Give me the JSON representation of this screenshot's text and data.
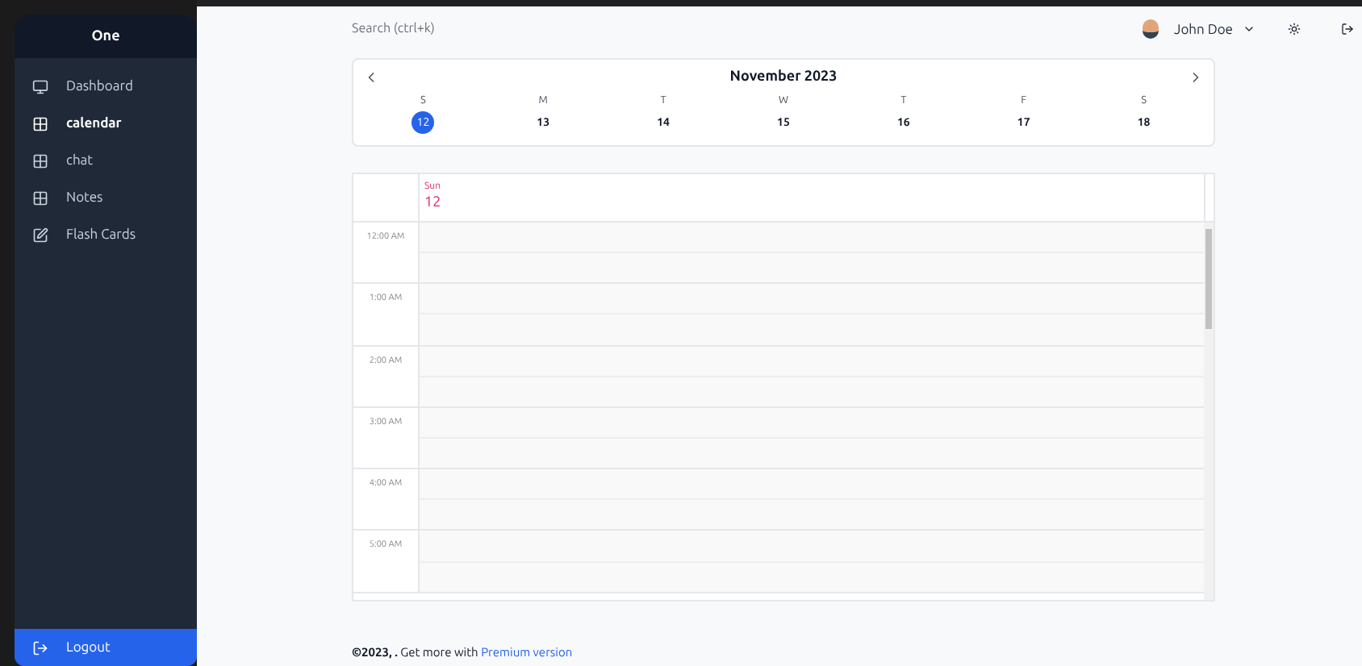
{
  "sidebar": {
    "title": "One",
    "items": [
      {
        "label": "Dashboard",
        "kind": "monitor",
        "selected": false
      },
      {
        "label": "calendar",
        "kind": "grid",
        "selected": true
      },
      {
        "label": "chat",
        "kind": "grid",
        "selected": false
      },
      {
        "label": "Notes",
        "kind": "grid",
        "selected": false
      },
      {
        "label": "Flash Cards",
        "kind": "edit",
        "selected": false
      }
    ],
    "logout": "Logout"
  },
  "header": {
    "search": {
      "placeholder": "Search (ctrl+k)"
    },
    "user": "John Doe"
  },
  "week_picker": {
    "month": "November 2023",
    "days": [
      {
        "letter": "S",
        "date": "12",
        "selected": true
      },
      {
        "letter": "M",
        "date": "13",
        "selected": false
      },
      {
        "letter": "T",
        "date": "14",
        "selected": false
      },
      {
        "letter": "W",
        "date": "15",
        "selected": false
      },
      {
        "letter": "T",
        "date": "16",
        "selected": false
      },
      {
        "letter": "F",
        "date": "17",
        "selected": false
      },
      {
        "letter": "S",
        "date": "18",
        "selected": false
      }
    ]
  },
  "day_view": {
    "weekday": "Sun",
    "date": "12",
    "hours": [
      "12:00 AM",
      "1:00 AM",
      "2:00 AM",
      "3:00 AM",
      "4:00 AM",
      "5:00 AM"
    ]
  },
  "footer": {
    "text": "**©2023, .** Get more with",
    "link": "Premium version"
  }
}
